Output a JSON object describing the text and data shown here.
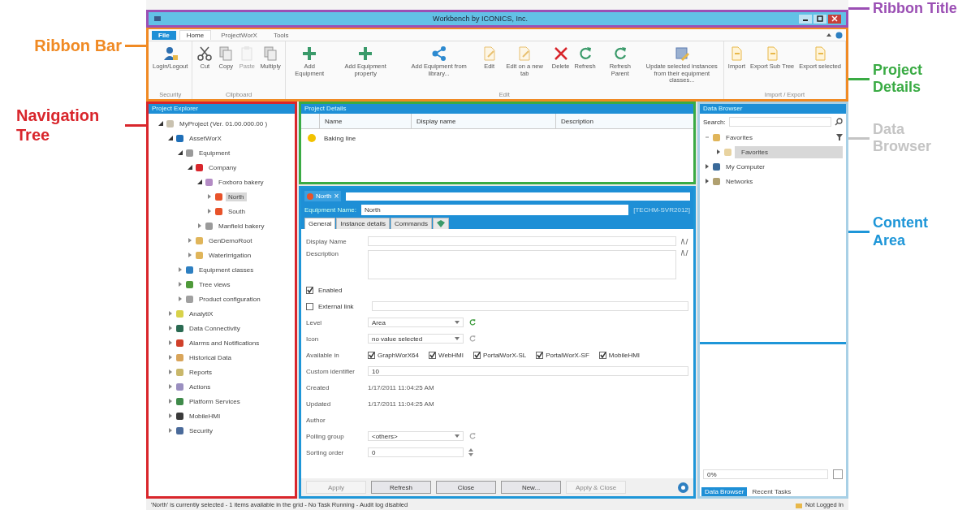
{
  "annotations_left": [
    {
      "text": "Ribbon Bar",
      "color": "#f08a24"
    },
    {
      "text": "Navigation Tree",
      "color": "#d9262c"
    }
  ],
  "annotations_right": [
    {
      "text": "Ribbon Title",
      "color": "#9b4fb4"
    },
    {
      "text": "Project Details",
      "color": "#3aab44"
    },
    {
      "text": "Data Browser",
      "color": "#c4c4c4"
    },
    {
      "text": "Content Area",
      "color": "#1e96d8"
    }
  ],
  "window": {
    "title": "Workbench by ICONICS, Inc."
  },
  "ribbon": {
    "file_button": "File",
    "tabs": [
      {
        "label": "Home",
        "selected": true
      },
      {
        "label": "ProjectWorX",
        "selected": false
      },
      {
        "label": "Tools",
        "selected": false
      }
    ],
    "groups": [
      {
        "label": "Security",
        "buttons": [
          {
            "label": "Login/Logout",
            "kind": "user",
            "disabled": false
          }
        ]
      },
      {
        "label": "Clipboard",
        "buttons": [
          {
            "label": "Cut",
            "kind": "cut",
            "disabled": false
          },
          {
            "label": "Copy",
            "kind": "copy",
            "disabled": false
          },
          {
            "label": "Paste",
            "kind": "paste",
            "disabled": true
          },
          {
            "label": "Multiply",
            "kind": "copy",
            "disabled": false
          }
        ]
      },
      {
        "label": "Edit",
        "buttons": [
          {
            "label": "Add Equipment",
            "kind": "plus",
            "disabled": false
          },
          {
            "label": "Add Equipment property",
            "kind": "plus",
            "disabled": false
          },
          {
            "label": "Add Equipment from library...",
            "kind": "share",
            "disabled": false
          },
          {
            "label": "Edit",
            "kind": "page",
            "disabled": false
          },
          {
            "label": "Edit on a new tab",
            "kind": "page",
            "disabled": false
          },
          {
            "label": "Delete",
            "kind": "delete",
            "disabled": false
          },
          {
            "label": "Refresh",
            "kind": "refresh",
            "disabled": false
          },
          {
            "label": "Refresh Parent",
            "kind": "refresh",
            "disabled": false
          },
          {
            "label": "Update selected instances from their equipment classes...",
            "kind": "update",
            "disabled": false
          }
        ]
      },
      {
        "label": "Import / Export",
        "buttons": [
          {
            "label": "Import",
            "kind": "doc",
            "disabled": false
          },
          {
            "label": "Export Sub Tree",
            "kind": "doc",
            "disabled": false
          },
          {
            "label": "Export selected",
            "kind": "doc",
            "disabled": false
          }
        ]
      }
    ]
  },
  "project_explorer": {
    "title": "Project Explorer",
    "items": [
      {
        "label": "MyProject (Ver. 01.00.000.00 )",
        "expanded": true,
        "selected": false,
        "color": "#c9c2b0",
        "children": [
          {
            "label": "AssetWorX",
            "expanded": true,
            "selected": false,
            "color": "#1f6fb8",
            "children": [
              {
                "label": "Equipment",
                "expanded": true,
                "selected": false,
                "color": "#9a9a9a",
                "children": [
                  {
                    "label": "Company",
                    "expanded": true,
                    "selected": false,
                    "color": "#d8262c",
                    "children": [
                      {
                        "label": "Foxboro bakery",
                        "expanded": true,
                        "selected": false,
                        "color": "#b38bc4",
                        "children": [
                          {
                            "label": "North",
                            "expanded": false,
                            "selected": true,
                            "color": "#e8532a"
                          },
                          {
                            "label": "South",
                            "expanded": false,
                            "selected": false,
                            "color": "#e8532a"
                          }
                        ]
                      },
                      {
                        "label": "Manfield bakery",
                        "expanded": false,
                        "selected": false,
                        "color": "#9a9a9a"
                      }
                    ]
                  },
                  {
                    "label": "GenDemoRoot",
                    "expanded": false,
                    "selected": false,
                    "color": "#e0b55a"
                  },
                  {
                    "label": "WaterIrrigation",
                    "expanded": false,
                    "selected": false,
                    "color": "#e0b55a"
                  }
                ]
              },
              {
                "label": "Equipment classes",
                "expanded": false,
                "selected": false,
                "color": "#2d7fc1"
              },
              {
                "label": "Tree views",
                "expanded": false,
                "selected": false,
                "color": "#4f9a3a"
              },
              {
                "label": "Product configuration",
                "expanded": false,
                "selected": false,
                "color": "#a0a0a0"
              }
            ]
          },
          {
            "label": "AnalytiX",
            "expanded": false,
            "selected": false,
            "color": "#d8d24a"
          },
          {
            "label": "Data Connectivity",
            "expanded": false,
            "selected": false,
            "color": "#2a6a52"
          },
          {
            "label": "Alarms and Notifications",
            "expanded": false,
            "selected": false,
            "color": "#d0402a"
          },
          {
            "label": "Historical Data",
            "expanded": false,
            "selected": false,
            "color": "#d9a55a"
          },
          {
            "label": "Reports",
            "expanded": false,
            "selected": false,
            "color": "#c9b76a"
          },
          {
            "label": "Actions",
            "expanded": false,
            "selected": false,
            "color": "#9a8fc0"
          },
          {
            "label": "Platform Services",
            "expanded": false,
            "selected": false,
            "color": "#3f8a4a"
          },
          {
            "label": "MobileHMI",
            "expanded": false,
            "selected": false,
            "color": "#3a3a3a"
          },
          {
            "label": "Security",
            "expanded": false,
            "selected": false,
            "color": "#4a6a9a"
          }
        ]
      }
    ]
  },
  "project_details": {
    "title": "Project Details",
    "columns": [
      "Name",
      "Display name",
      "Description"
    ],
    "rows": [
      {
        "name": "Baking line",
        "color": "#f2c200"
      }
    ]
  },
  "content": {
    "tab": {
      "label": "North",
      "close": "×"
    },
    "equipment_name": {
      "label": "Equipment Name:",
      "value": "North",
      "server": "[TECHM-SVR2012]"
    },
    "subtabs": [
      {
        "label": "General",
        "selected": true,
        "kind": "text"
      },
      {
        "label": "Instance details",
        "selected": false,
        "kind": "text"
      },
      {
        "label": "Commands",
        "selected": false,
        "kind": "text"
      },
      {
        "selected": false,
        "kind": "icon"
      }
    ],
    "form": [
      {
        "kind": "text",
        "label": "Display Name"
      },
      {
        "kind": "textarea",
        "label": "Description"
      },
      {
        "kind": "check",
        "label": "Enabled",
        "checked": true
      },
      {
        "kind": "check_field",
        "label": "External link",
        "checked": false
      },
      {
        "kind": "select",
        "label": "Level",
        "value": "Area",
        "refresh_active": true
      },
      {
        "kind": "select",
        "label": "Icon",
        "value": "no value selected",
        "refresh_active": false
      },
      {
        "kind": "checks",
        "label": "Available in",
        "options": [
          {
            "label": "GraphWorX64",
            "checked": true
          },
          {
            "label": "WebHMI",
            "checked": true
          },
          {
            "label": "PortalWorX-SL",
            "checked": true
          },
          {
            "label": "PortalWorX-SF",
            "checked": true
          },
          {
            "label": "MobileHMI",
            "checked": true
          }
        ]
      },
      {
        "kind": "input",
        "label": "Custom identifier",
        "value": "10"
      },
      {
        "kind": "static",
        "label": "Created",
        "value": "1/17/2011 11:04:25 AM"
      },
      {
        "kind": "static",
        "label": "Updated",
        "value": "1/17/2011 11:04:25 AM"
      },
      {
        "kind": "static",
        "label": "Author"
      },
      {
        "kind": "select",
        "label": "Polling group",
        "value": "<others>",
        "refresh_active": false
      },
      {
        "kind": "spin",
        "label": "Sorting order",
        "value": "0"
      }
    ],
    "buttons": [
      {
        "label": "Apply",
        "disabled": true
      },
      {
        "label": "Refresh",
        "disabled": false
      },
      {
        "label": "Close",
        "disabled": false
      },
      {
        "label": "New...",
        "disabled": false
      },
      {
        "label": "Apply & Close",
        "disabled": true
      }
    ]
  },
  "data_browser": {
    "title": "Data Browser",
    "search_label": "Search:",
    "items": [
      {
        "label": "Favorites",
        "expanded": true,
        "selected": false,
        "color": "#e0b55a",
        "children": [
          {
            "label": "Favorites",
            "expanded": false,
            "selected": true,
            "color": "#e8d3a0"
          }
        ]
      },
      {
        "label": "My Computer",
        "expanded": false,
        "selected": false,
        "color": "#3a6a9a"
      },
      {
        "label": "Networks",
        "expanded": false,
        "selected": false,
        "color": "#b0a070"
      }
    ],
    "zoom": "0%",
    "tabs": [
      {
        "label": "Data Browser",
        "selected": true
      },
      {
        "label": "Recent Tasks",
        "selected": false
      }
    ]
  },
  "status_bar": {
    "text": "'North' is currently selected - 1 items available in the grid - No Task Running - Audit log disabled",
    "login": "Not Logged In"
  }
}
